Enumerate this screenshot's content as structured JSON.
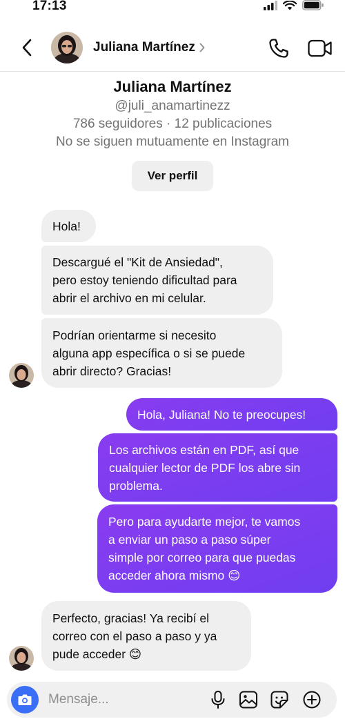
{
  "status": {
    "time": "17:13"
  },
  "header": {
    "name": "Juliana Martínez",
    "chevron": "›"
  },
  "profile": {
    "name": "Juliana Martínez",
    "handle": "@juli_anamartinezz",
    "stats": "786 seguidores · 12 publicaciones",
    "mutual": "No se siguen mutuamente en Instagram",
    "view_button": "Ver perfil"
  },
  "messages": [
    {
      "from": "them",
      "text": "Hola!"
    },
    {
      "from": "them",
      "text": " Descargué el \"Kit de Ansiedad\",\npero estoy teniendo dificultad para\nabrir el archivo en mi celular."
    },
    {
      "from": "them",
      "text": "Podrían orientarme si necesito\nalguna app específica o si se puede\nabrir directo? Gracias!"
    },
    {
      "from": "me",
      "text": "Hola, Juliana! No te preocupes!"
    },
    {
      "from": "me",
      "text": "Los archivos están en PDF, así que\ncualquier lector de PDF los abre sin\nproblema."
    },
    {
      "from": "me",
      "text": "Pero para ayudarte mejor, te vamos\na enviar un paso a paso súper\nsimple por correo para que puedas\nacceder ahora mismo 😊"
    },
    {
      "from": "them",
      "text": "Perfecto, gracias! Ya recibí el\ncorreo con el paso a paso y ya\npude acceder 😊"
    }
  ],
  "composer": {
    "placeholder": "Mensaje..."
  },
  "colors": {
    "outgoing": "#7a3df0",
    "incoming": "#efefef",
    "camera": "#3b6ef6"
  },
  "icons": [
    "back-arrow-icon",
    "phone-icon",
    "video-camera-icon",
    "camera-icon",
    "microphone-icon",
    "image-icon",
    "sticker-icon",
    "add-circle-icon"
  ]
}
